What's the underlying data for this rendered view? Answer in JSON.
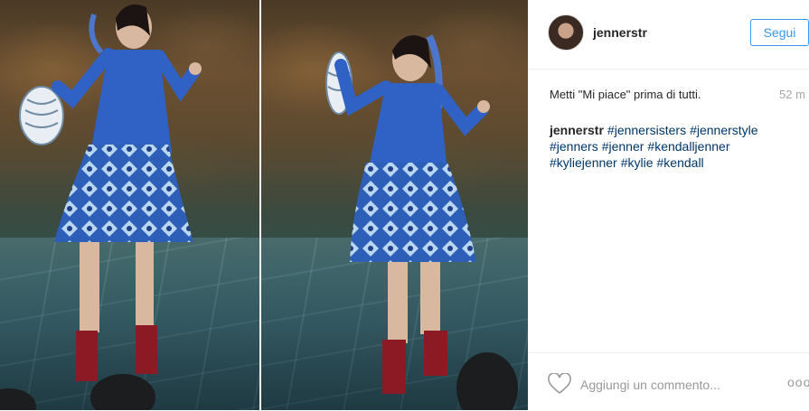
{
  "post": {
    "photo_alt_left": "",
    "photo_alt_right": ""
  },
  "header": {
    "username": "jennerstr",
    "follow_label": "Segui"
  },
  "meta": {
    "likes_text": "Metti \"Mi piace\" prima di tutti.",
    "time_text": "52 m"
  },
  "caption": {
    "author": "jennerstr",
    "hashtags": [
      "#jennersisters",
      "#jennerstyle",
      "#jenners",
      "#jenner",
      "#kendalljenner",
      "#kyliejenner",
      "#kylie",
      "#kendall"
    ]
  },
  "footer": {
    "comment_placeholder": "Aggiungi un commento...",
    "more_label": "ooo"
  },
  "colors": {
    "accent": "#3897f0",
    "hashtag": "#003569",
    "muted": "#999999"
  }
}
